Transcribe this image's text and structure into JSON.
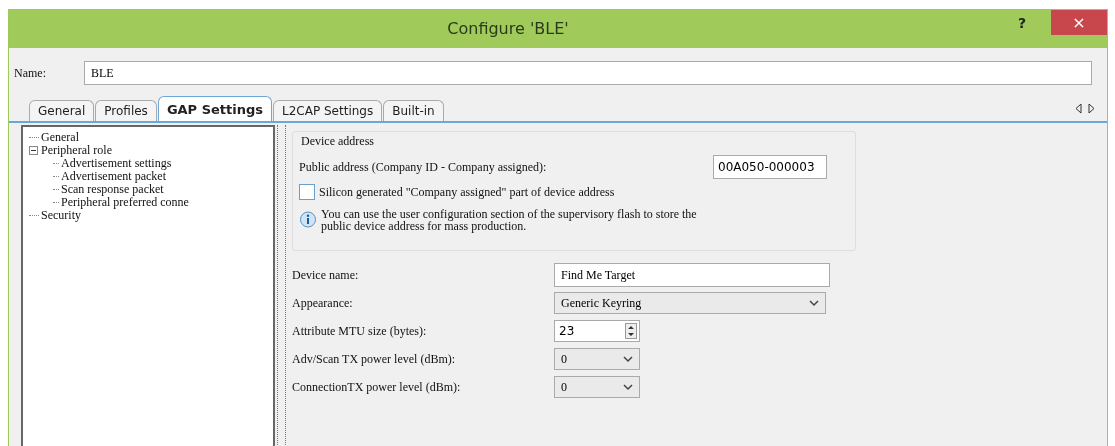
{
  "window": {
    "title": "Configure 'BLE'",
    "help": "?",
    "close": "×"
  },
  "name_field": {
    "label": "Name:",
    "value": "BLE"
  },
  "tabs": [
    {
      "label": "General",
      "selected": false
    },
    {
      "label": "Profiles",
      "selected": false
    },
    {
      "label": "GAP Settings",
      "selected": true
    },
    {
      "label": "L2CAP Settings",
      "selected": false
    },
    {
      "label": "Built-in",
      "selected": false
    }
  ],
  "tree": [
    {
      "label": "General"
    },
    {
      "label": "Peripheral role",
      "expanded": true,
      "children": [
        {
          "label": "Advertisement settings"
        },
        {
          "label": "Advertisement packet"
        },
        {
          "label": "Scan response packet"
        },
        {
          "label": "Peripheral preferred conne"
        }
      ]
    },
    {
      "label": "Security"
    }
  ],
  "device_address": {
    "title": "Device address",
    "public_label": "Public address (Company ID - Company assigned):",
    "public_value": "00A050-000003",
    "checkbox": {
      "label": "Silicon generated \"Company assigned\" part of device address",
      "checked": false
    },
    "info": "You can use the user configuration section of the supervisory flash to store the public device address for mass production."
  },
  "fields": [
    {
      "kind": "text",
      "label": "Device name:",
      "value": "Find Me Target"
    },
    {
      "kind": "select",
      "label": "Appearance:",
      "value": "Generic Keyring"
    },
    {
      "kind": "spin",
      "label": "Attribute MTU size (bytes):",
      "value": "23"
    },
    {
      "kind": "select_small",
      "label": "Adv/Scan TX power level (dBm):",
      "value": "0"
    },
    {
      "kind": "select_small",
      "label": "ConnectionTX power level (dBm):",
      "value": "0"
    }
  ]
}
